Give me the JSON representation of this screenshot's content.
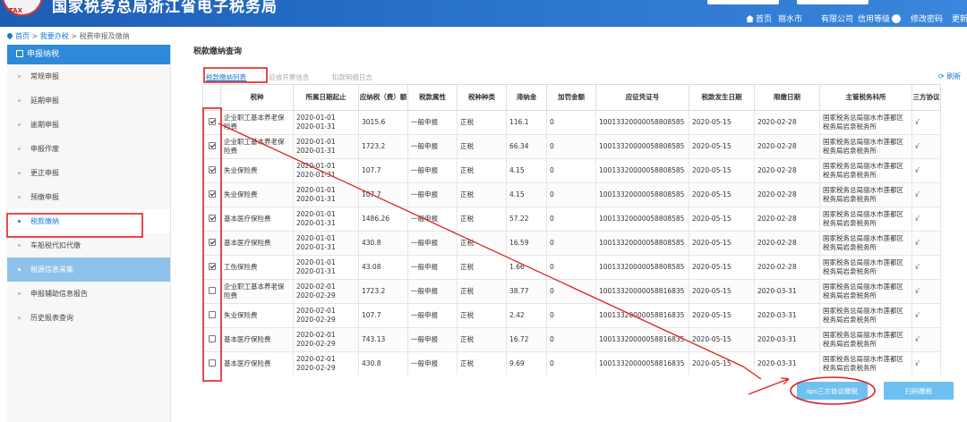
{
  "header": {
    "title": "国家税务总局浙江省电子税务局",
    "nav_home": "首页",
    "nav_city": "丽水市",
    "nav_company": "有限公司",
    "nav_credit": "信用等级",
    "nav_change_pwd": "修改密码",
    "nav_more": "更新"
  },
  "breadcrumb": {
    "home": "首页",
    "sep1": ">",
    "level2": "我要办税",
    "sep2": ">",
    "level3": "税费申报及缴纳"
  },
  "sidebar": {
    "heading": "申报纳税",
    "items": [
      {
        "label": "常规申报"
      },
      {
        "label": "延期申报"
      },
      {
        "label": "逾期申报"
      },
      {
        "label": "申报作废"
      },
      {
        "label": "更正申报"
      },
      {
        "label": "预缴申报"
      },
      {
        "label": "税款缴纳"
      },
      {
        "label": "车船税代扣代缴"
      },
      {
        "label": "税源信息采集"
      },
      {
        "label": "申报辅助信息报告"
      },
      {
        "label": "历史报表查询"
      }
    ]
  },
  "main": {
    "title": "税款缴纳查询",
    "tabs": [
      {
        "label": "税款缴纳列表"
      },
      {
        "label": "征收开票信息"
      },
      {
        "label": "扣款明细日志"
      }
    ],
    "refresh_label": "刷新",
    "columns": [
      "税种",
      "所属日期起止",
      "应纳税（费）额",
      "税款属性",
      "税种种类",
      "滞纳金",
      "加罚金额",
      "应征凭证号",
      "税款发生日期",
      "限缴日期",
      "主管税务科所",
      "三方协议"
    ],
    "rows": [
      {
        "checked": true,
        "tax": "企业职工基本养老保险费",
        "period1": "2020-01-01",
        "period2": "2020-01-31",
        "amount": "3015.6",
        "attr": "一般申报",
        "kind": "正税",
        "late": "116.1",
        "penalty": "0",
        "voucher": "10013320000058808585",
        "occur": "2020-05-15",
        "deadline": "2020-02-28",
        "office": "国家税务总局丽水市莲都区税务局岩泉税务所",
        "tripartite": "√"
      },
      {
        "checked": true,
        "tax": "企业职工基本养老保险费",
        "period1": "2020-01-01",
        "period2": "2020-01-31",
        "amount": "1723.2",
        "attr": "一般申报",
        "kind": "正税",
        "late": "66.34",
        "penalty": "0",
        "voucher": "10013320000058808585",
        "occur": "2020-05-15",
        "deadline": "2020-02-28",
        "office": "国家税务总局丽水市莲都区税务局岩泉税务所",
        "tripartite": "√"
      },
      {
        "checked": true,
        "tax": "失业保险费",
        "period1": "2020-01-01",
        "period2": "2020-01-31",
        "amount": "107.7",
        "attr": "一般申报",
        "kind": "正税",
        "late": "4.15",
        "penalty": "0",
        "voucher": "10013320000058808585",
        "occur": "2020-05-15",
        "deadline": "2020-02-28",
        "office": "国家税务总局丽水市莲都区税务局岩泉税务所",
        "tripartite": "√"
      },
      {
        "checked": true,
        "tax": "失业保险费",
        "period1": "2020-01-01",
        "period2": "2020-01-31",
        "amount": "107.7",
        "attr": "一般申报",
        "kind": "正税",
        "late": "4.15",
        "penalty": "0",
        "voucher": "10013320000058808585",
        "occur": "2020-05-15",
        "deadline": "2020-02-28",
        "office": "国家税务总局丽水市莲都区税务局岩泉税务所",
        "tripartite": "√"
      },
      {
        "checked": true,
        "tax": "基本医疗保险费",
        "period1": "2020-01-01",
        "period2": "2020-01-31",
        "amount": "1486.26",
        "attr": "一般申报",
        "kind": "正税",
        "late": "57.22",
        "penalty": "0",
        "voucher": "10013320000058808585",
        "occur": "2020-05-15",
        "deadline": "2020-02-28",
        "office": "国家税务总局丽水市莲都区税务局岩泉税务所",
        "tripartite": "√"
      },
      {
        "checked": true,
        "tax": "基本医疗保险费",
        "period1": "2020-01-01",
        "period2": "2020-01-31",
        "amount": "430.8",
        "attr": "一般申报",
        "kind": "正税",
        "late": "16.59",
        "penalty": "0",
        "voucher": "10013320000058808585",
        "occur": "2020-05-15",
        "deadline": "2020-02-28",
        "office": "国家税务总局丽水市莲都区税务局岩泉税务所",
        "tripartite": "√"
      },
      {
        "checked": true,
        "tax": "工伤保险费",
        "period1": "2020-01-01",
        "period2": "2020-01-31",
        "amount": "43.08",
        "attr": "一般申报",
        "kind": "正税",
        "late": "1.66",
        "penalty": "0",
        "voucher": "10013320000058808585",
        "occur": "2020-05-15",
        "deadline": "2020-02-28",
        "office": "国家税务总局丽水市莲都区税务局岩泉税务所",
        "tripartite": "√"
      },
      {
        "checked": false,
        "tax": "企业职工基本养老保险费",
        "period1": "2020-02-01",
        "period2": "2020-02-29",
        "amount": "1723.2",
        "attr": "一般申报",
        "kind": "正税",
        "late": "38.77",
        "penalty": "0",
        "voucher": "10013320000058816835",
        "occur": "2020-05-15",
        "deadline": "2020-03-31",
        "office": "国家税务总局丽水市莲都区税务局岩泉税务所",
        "tripartite": "√"
      },
      {
        "checked": false,
        "tax": "失业保险费",
        "period1": "2020-02-01",
        "period2": "2020-02-29",
        "amount": "107.7",
        "attr": "一般申报",
        "kind": "正税",
        "late": "2.42",
        "penalty": "0",
        "voucher": "10013320000058816835",
        "occur": "2020-05-15",
        "deadline": "2020-03-31",
        "office": "国家税务总局丽水市莲都区税务局岩泉税务所",
        "tripartite": "√"
      },
      {
        "checked": false,
        "tax": "基本医疗保险费",
        "period1": "2020-02-01",
        "period2": "2020-02-29",
        "amount": "743.13",
        "attr": "一般申报",
        "kind": "正税",
        "late": "16.72",
        "penalty": "0",
        "voucher": "10013320000058816835",
        "occur": "2020-05-15",
        "deadline": "2020-03-31",
        "office": "国家税务总局丽水市莲都区税务局岩泉税务所",
        "tripartite": "√"
      },
      {
        "checked": false,
        "tax": "基本医疗保险费",
        "period1": "2020-02-01",
        "period2": "2020-02-29",
        "amount": "430.8",
        "attr": "一般申报",
        "kind": "正税",
        "late": "9.69",
        "penalty": "0",
        "voucher": "10013320000058816835",
        "occur": "2020-05-15",
        "deadline": "2020-03-31",
        "office": "国家税务总局丽水市莲都区税务局岩泉税务所",
        "tripartite": "√"
      }
    ],
    "btn_tips": "tips三方协议缴税",
    "btn_scan": "扫码缴税"
  },
  "colors": {
    "header_blue": "#1d5db3",
    "accent": "#1a7ad2",
    "button": "#6ec0f0",
    "annotation_red": "#e02020"
  }
}
